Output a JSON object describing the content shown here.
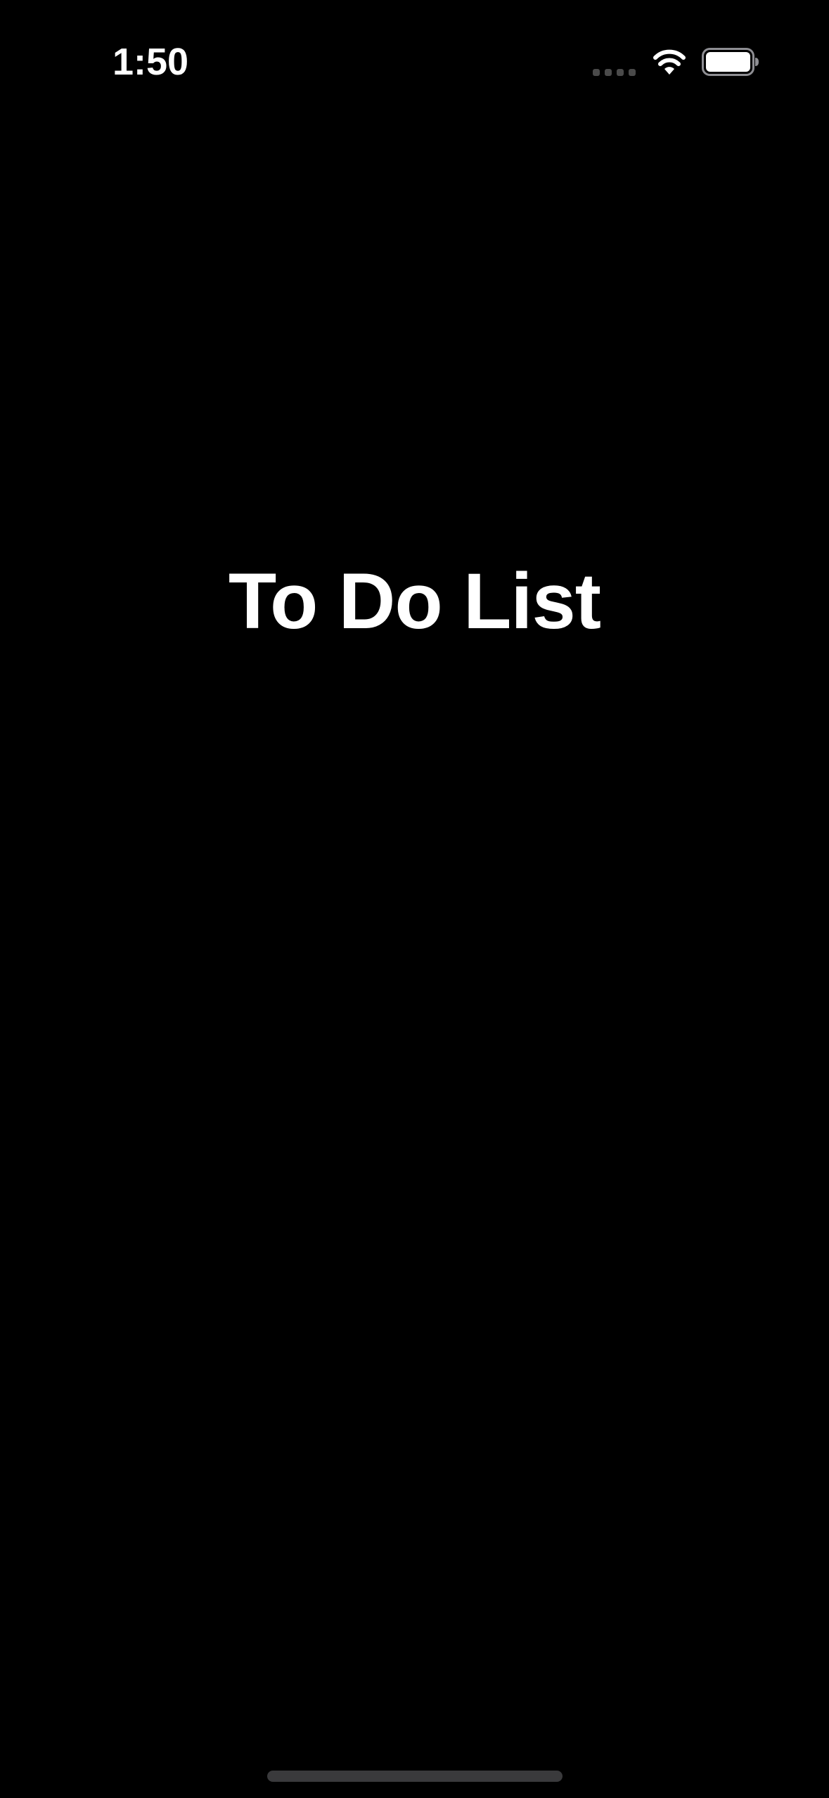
{
  "status_bar": {
    "time": "1:50",
    "icons": [
      "cellular-signal-icon",
      "wifi-icon",
      "battery-icon"
    ]
  },
  "main": {
    "title": "To Do List"
  },
  "colors": {
    "background": "#000000",
    "text": "#ffffff",
    "signal_inactive": "#4a4a4a",
    "home_indicator": "#3a3a3c"
  }
}
